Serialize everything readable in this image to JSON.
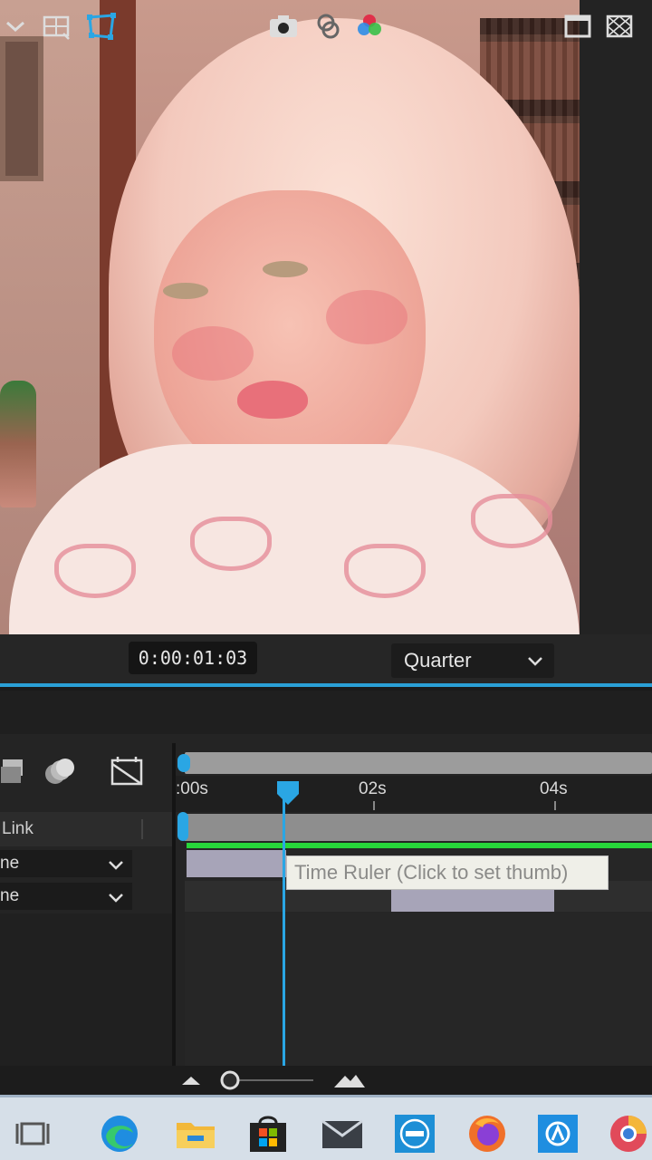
{
  "viewer": {
    "timecode": "0:00:01:03",
    "resolution": "Quarter"
  },
  "timeline": {
    "ruler_labels": [
      ":00s",
      "02s",
      "04s"
    ],
    "layer_header": "Link",
    "mode_rows": [
      "ne",
      "ne"
    ],
    "tooltip": "Time Ruler (Click to set thumb)"
  },
  "colors": {
    "accent_blue": "#2aa6e4",
    "green_bar": "#27d63a",
    "layer_bar": "#a7a4b8"
  },
  "taskbar": {
    "icons": [
      "task-view-icon",
      "edge-icon",
      "file-explorer-icon",
      "microsoft-store-icon",
      "mail-icon",
      "dell-icon",
      "firefox-icon",
      "app-icon",
      "chrome-like-icon"
    ]
  }
}
